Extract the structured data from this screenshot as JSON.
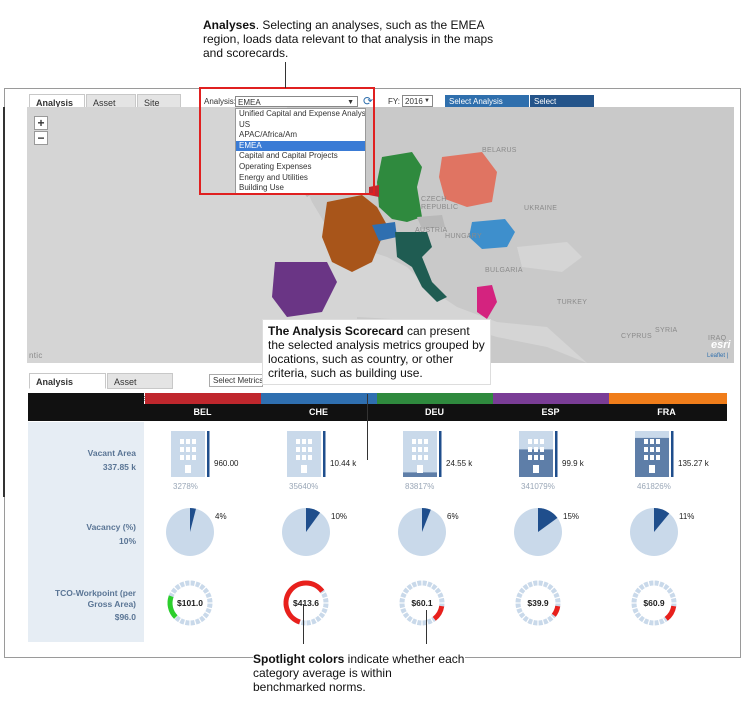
{
  "callouts": {
    "analyses": {
      "bold": "Analyses",
      "text": ". Selecting an analyses, such as the EMEA region, loads data relevant to that analysis in the maps and scorecards."
    },
    "scorecard": {
      "bold": "The Analysis Scorecard",
      "text": " can present the selected analysis metrics grouped by locations, such as country, or other criteria, such as building use."
    },
    "spotlight": {
      "bold": "Spotlight colors",
      "text": " indicate whether each category average is within benchmarked norms."
    }
  },
  "top_tabs": [
    "Analysis Map",
    "Asset Map",
    "Site Map"
  ],
  "analysis_label": "Analysis:",
  "analysis_selected": "EMEA",
  "analysis_options": [
    "Unified Capital and Expense Analysis",
    "US",
    "APAC/Africa/Am",
    "EMEA",
    "Capital and Capital Projects",
    "Operating Expenses",
    "Energy and Utilities",
    "Building Use"
  ],
  "fy_label": "FY:",
  "fy_value": "2016",
  "buttons": {
    "select_group": "Select Analysis Group",
    "select_countries": "Select Countries"
  },
  "zoom": {
    "plus": "+",
    "minus": "−"
  },
  "map_labels": {
    "belarus": "BELARUS",
    "czech": "CZECH REPUBLIC",
    "ukraine": "UKRAINE",
    "austria": "AUSTRIA",
    "hungary": "HUNGARY",
    "bulgaria": "BULGARIA",
    "turkey": "TURKEY",
    "syria": "SYRIA",
    "cyprus": "CYPRUS",
    "iraq": "IRAQ",
    "atlantic": "ntic",
    "esri": "esri",
    "leaflet": "Leaflet |"
  },
  "score_tabs": [
    "Analysis Scorecard",
    "Asset Scorecard"
  ],
  "select_metrics": "Select Metrics",
  "colors": {
    "BEL": "#c0272d",
    "CHE": "#2f6fb0",
    "DEU": "#2f8a3e",
    "ESP": "#7a3d96",
    "FRA": "#f07d1a",
    "fill_dark": "#1f4e8c",
    "fill_light": "#c9d9ea",
    "spot_green": "#2ccf2c",
    "spot_red": "#e8201c"
  },
  "countries": [
    "BEL",
    "CHE",
    "DEU",
    "ESP",
    "FRA"
  ],
  "rows": {
    "vacant_area": {
      "label": "Vacant Area",
      "avg": "337.85 k"
    },
    "vacancy": {
      "label": "Vacancy (%)",
      "avg": "10%"
    },
    "tco": {
      "label": "TCO-Workpoint (per Gross Area)",
      "avg": "$96.0"
    }
  },
  "vacant_values": [
    "960.00",
    "10.44 k",
    "24.55 k",
    "99.9 k",
    "135.27 k"
  ],
  "vacant_pcts": [
    "3278%",
    "35640%",
    "83817%",
    "341079%",
    "461826%"
  ],
  "vacant_fill": [
    0.0,
    0.0,
    0.1,
    0.6,
    0.85
  ],
  "vacancy_values": [
    4,
    10,
    6,
    15,
    11
  ],
  "vacancy_labels": [
    "4%",
    "10%",
    "6%",
    "15%",
    "11%"
  ],
  "tco_values": [
    "$101.0",
    "$413.6",
    "$60.1",
    "$39.9",
    "$60.9"
  ],
  "tco_spot": [
    {
      "color": "spot_green",
      "frac": 0.18
    },
    {
      "color": "spot_red",
      "frac": 0.6
    },
    {
      "color": "spot_red",
      "frac": 0.12
    },
    {
      "color": "spot_red",
      "frac": 0.08
    },
    {
      "color": "spot_red",
      "frac": 0.12
    }
  ]
}
